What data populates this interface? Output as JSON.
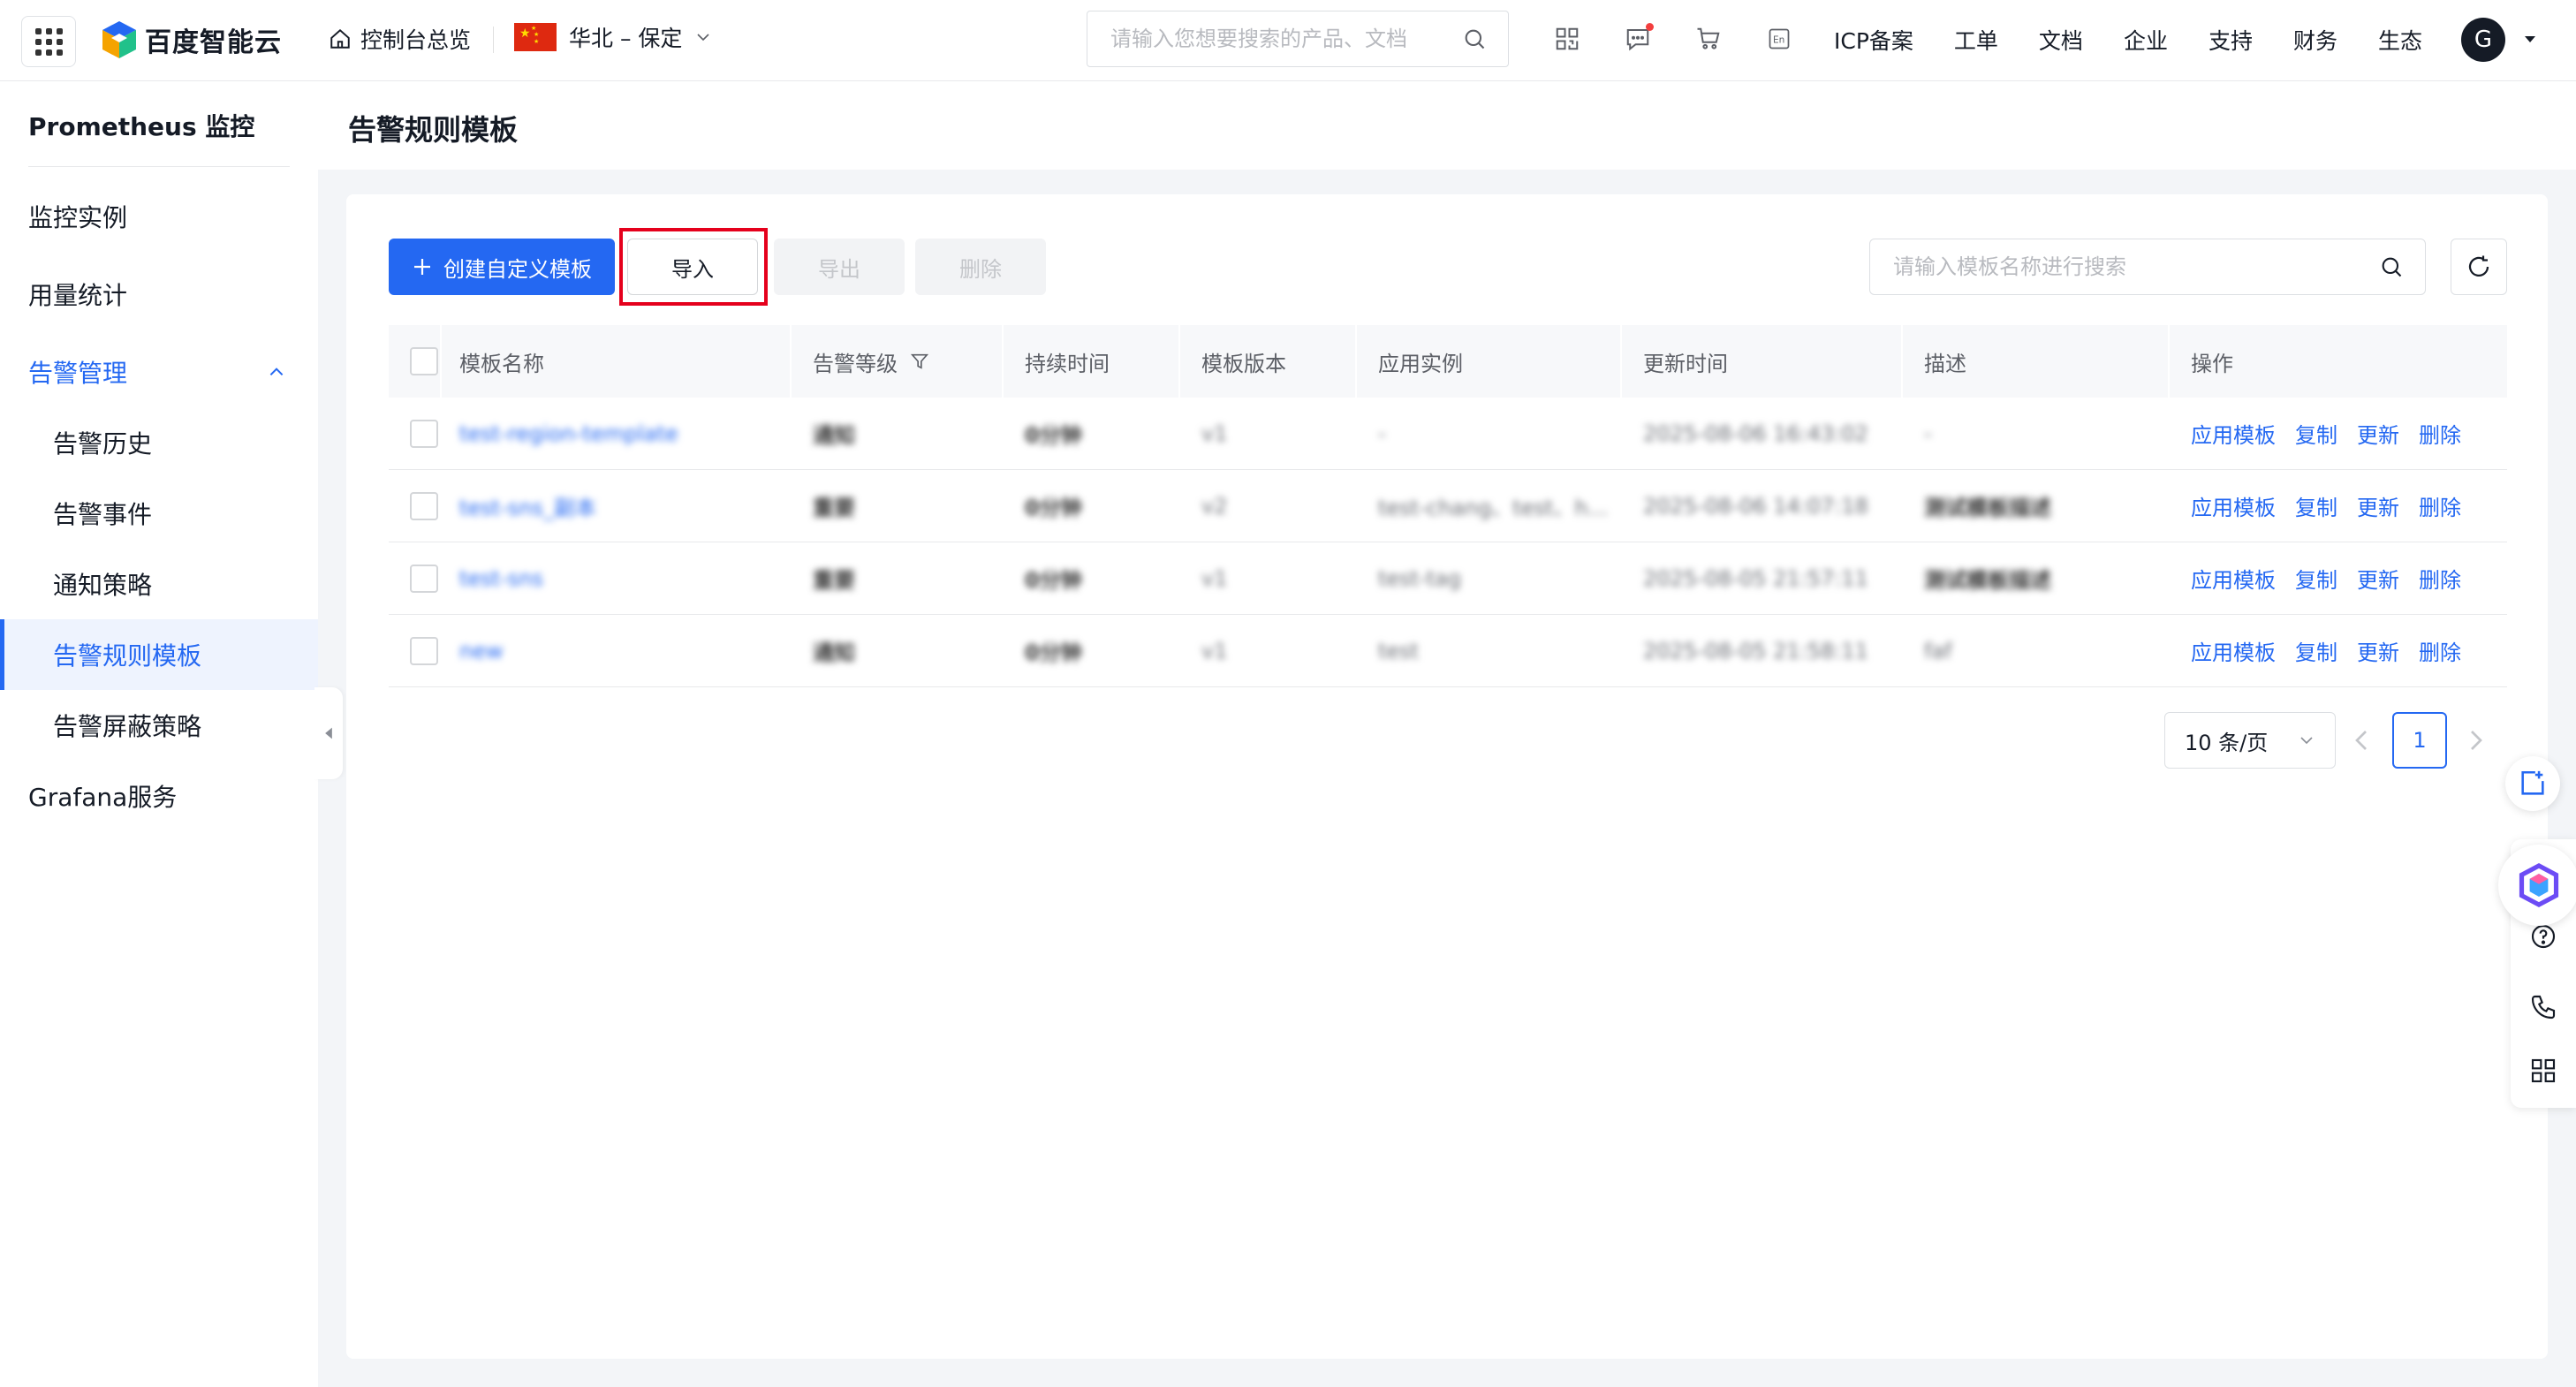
{
  "header": {
    "brand": "百度智能云",
    "console_home": "控制台总览",
    "region": "华北 – 保定",
    "search_placeholder": "请输入您想要搜索的产品、文档",
    "links": [
      "ICP备案",
      "工单",
      "文档",
      "企业",
      "支持",
      "财务",
      "生态"
    ],
    "avatar_letter": "G",
    "icons": [
      "qrcode-icon",
      "message-icon",
      "cart-icon",
      "language-en-icon"
    ]
  },
  "sidebar": {
    "title": "Prometheus 监控",
    "items": [
      {
        "label": "监控实例"
      },
      {
        "label": "用量统计"
      },
      {
        "label": "告警管理"
      },
      {
        "label": "告警历史"
      },
      {
        "label": "告警事件"
      },
      {
        "label": "通知策略"
      },
      {
        "label": "告警规则模板"
      },
      {
        "label": "告警屏蔽策略"
      },
      {
        "label": "Grafana服务"
      }
    ]
  },
  "page": {
    "title": "告警规则模板"
  },
  "toolbar": {
    "create_label": "创建自定义模板",
    "import_label": "导入",
    "export_label": "导出",
    "delete_label": "删除",
    "search_placeholder": "请输入模板名称进行搜索"
  },
  "table": {
    "columns": [
      "模板名称",
      "告警等级",
      "持续时间",
      "模板版本",
      "应用实例",
      "更新时间",
      "描述",
      "操作"
    ],
    "rows": [
      {
        "name": "test-region-template",
        "level": "通知",
        "duration": "0分钟",
        "version": "v1",
        "instance": "-",
        "updated": "2025-08-06 16:43:02",
        "desc": "-"
      },
      {
        "name": "test-sns_副本",
        "level": "重要",
        "duration": "0分钟",
        "version": "v2",
        "instance": "test-chang、test、h...",
        "updated": "2025-08-06 14:07:18",
        "desc": "测试模板描述"
      },
      {
        "name": "test-sns",
        "level": "重要",
        "duration": "0分钟",
        "version": "v1",
        "instance": "test-tag",
        "updated": "2025-08-05 21:57:11",
        "desc": "测试模板描述"
      },
      {
        "name": "new",
        "level": "通知",
        "duration": "0分钟",
        "version": "v1",
        "instance": "test",
        "updated": "2025-08-05 21:58:11",
        "desc": "faf"
      }
    ],
    "row_actions": [
      "应用模板",
      "复制",
      "更新",
      "删除"
    ]
  },
  "pagination": {
    "page_size": "10 条/页",
    "current_page": "1"
  },
  "colors": {
    "accent": "#2468f2",
    "highlight": "#e5001c"
  }
}
